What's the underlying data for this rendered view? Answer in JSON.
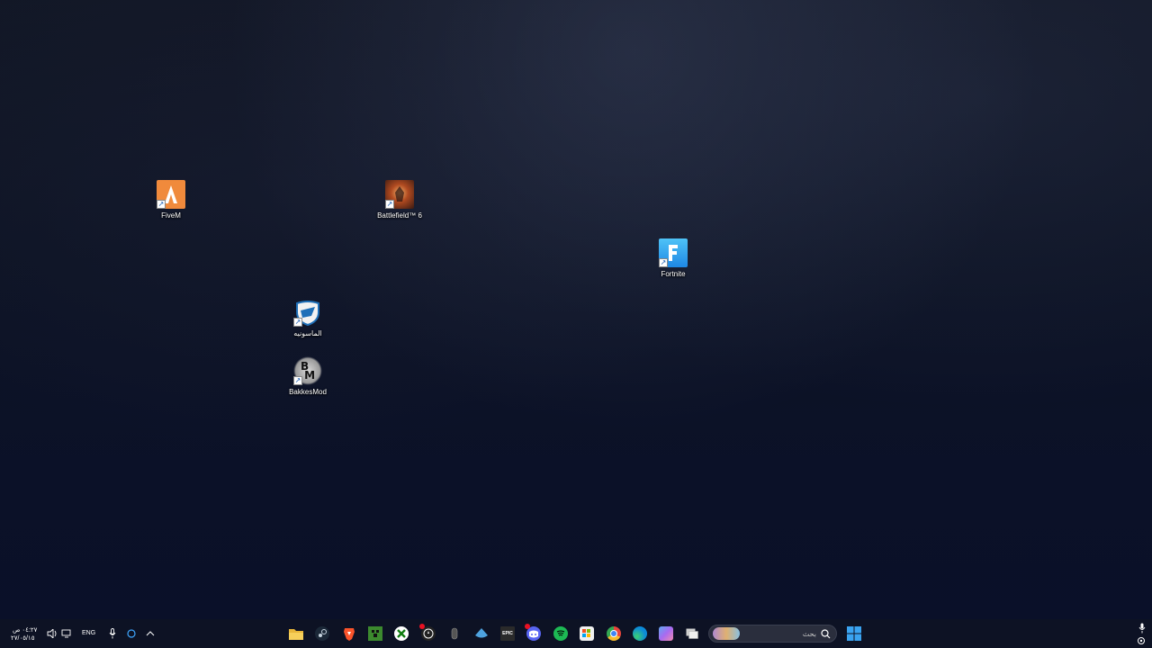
{
  "desktop": {
    "icons": [
      {
        "label": "FiveM",
        "icon": "fivem-icon",
        "color": "#f08a3c"
      },
      {
        "label": "Battlefield™ 6",
        "icon": "battlefield-icon",
        "color": "#7a3a20"
      },
      {
        "label": "Fortnite",
        "icon": "fortnite-icon",
        "color": "#2aa0e8"
      },
      {
        "label": "الماسونيه",
        "icon": "rocket-league-icon",
        "color": "#1e6fb8"
      },
      {
        "label": "BakkesMod",
        "icon": "bakkesmod-icon",
        "color": "#333333"
      }
    ]
  },
  "taskbar": {
    "apps": [
      {
        "name": "File Explorer",
        "icon": "folder-icon",
        "color": "#e8b63a"
      },
      {
        "name": "Steam",
        "icon": "steam-icon",
        "color": "#1b2838"
      },
      {
        "name": "Brave",
        "icon": "brave-icon",
        "color": "#fb542b"
      },
      {
        "name": "Minecraft",
        "icon": "minecraft-icon",
        "color": "#3c8a2e"
      },
      {
        "name": "Xbox",
        "icon": "xbox-icon",
        "color": "#107c10"
      },
      {
        "name": "Rockstar",
        "icon": "rockstar-icon",
        "color": "#222222"
      },
      {
        "name": "Mouse",
        "icon": "mouse-icon",
        "color": "#444444"
      },
      {
        "name": "Steam",
        "icon": "steam-icon",
        "color": "#1b2838"
      },
      {
        "name": "Epic Games",
        "icon": "epic-icon",
        "color": "#2a2a2a"
      },
      {
        "name": "Discord",
        "icon": "discord-icon",
        "color": "#5865f2"
      },
      {
        "name": "Spotify",
        "icon": "spotify-icon",
        "color": "#1db954"
      },
      {
        "name": "Microsoft Store",
        "icon": "store-icon",
        "color": "#f0f0f0"
      },
      {
        "name": "Chrome",
        "icon": "chrome-icon",
        "color": "#e8453c"
      },
      {
        "name": "Edge",
        "icon": "edge-icon",
        "color": "#0c8ad8"
      },
      {
        "name": "Copilot",
        "icon": "copilot-icon",
        "color": "#7a6af0"
      },
      {
        "name": "Task View",
        "icon": "taskview-icon",
        "color": "#d0d0d0"
      }
    ],
    "search_placeholder": "بحث",
    "start_label": "Start",
    "tray": {
      "time": "٠٤:٢٧ ص",
      "date": "٢٧/٠٥/١٥",
      "language": "ENG"
    },
    "epic_label": "EPIC"
  }
}
